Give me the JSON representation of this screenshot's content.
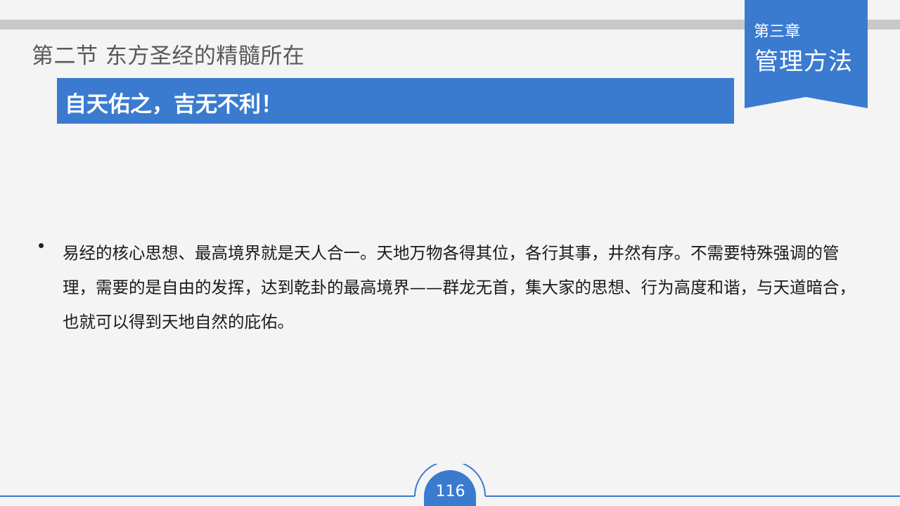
{
  "header": {
    "section_title": "第二节  东方圣经的精髓所在",
    "chapter_label": "第三章",
    "chapter_name": "管理方法"
  },
  "headline": {
    "text": "自天佑之，吉无不利！"
  },
  "body": {
    "bullets": [
      "易经的核心思想、最高境界就是天人合一。天地万物各得其位，各行其事，井然有序。不需要特殊强调的管理，需要的是自由的发挥，达到乾卦的最高境界——群龙无首，集大家的思想、行为高度和谐，与天道暗合，也就可以得到天地自然的庇佑。"
    ]
  },
  "footer": {
    "page_number": "116"
  },
  "colors": {
    "accent_blue": "#3a7bd0",
    "top_bar_gray": "#c8c8c8",
    "background": "#f4f4f4"
  }
}
